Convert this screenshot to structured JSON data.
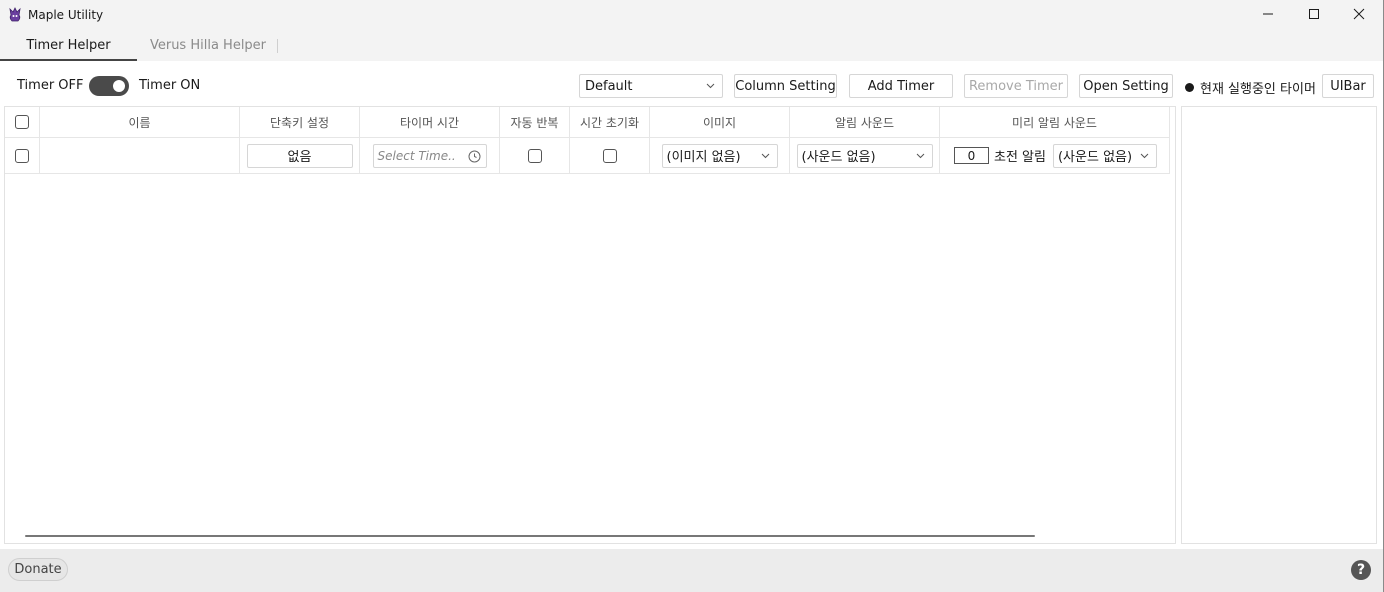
{
  "window": {
    "title": "Maple Utility",
    "controls": {
      "minimize": "minimize-icon",
      "maximize": "maximize-icon",
      "close": "close-icon"
    }
  },
  "tabs": [
    {
      "label": "Timer Helper",
      "active": true
    },
    {
      "label": "Verus Hilla Helper",
      "active": false
    }
  ],
  "toolbar": {
    "timer_off_label": "Timer OFF",
    "timer_on_label": "Timer ON",
    "toggle_state": "on",
    "preset_select": "Default",
    "column_setting": "Column Setting",
    "add_timer": "Add Timer",
    "remove_timer": "Remove Timer",
    "open_setting": "Open Setting",
    "running_timers": "현재 실행중인 타이머",
    "uibar": "UIBar"
  },
  "table": {
    "headers": {
      "name": "이름",
      "hotkey": "단축키 설정",
      "timer_time": "타이머 시간",
      "auto_repeat": "자동 반복",
      "time_reset": "시간 초기화",
      "image": "이미지",
      "alert_sound": "알림 사운드",
      "pre_alert_sound": "미리 알림 사운드"
    },
    "row": {
      "hotkey_value": "없음",
      "time_placeholder": "Select Time..",
      "image_value": "(이미지 없음)",
      "sound_value": "(사운드 없음)",
      "pre_alert_seconds": "0",
      "pre_alert_label": "초전 알림",
      "pre_alert_sound_value": "(사운드 없음)"
    }
  },
  "statusbar": {
    "donate": "Donate",
    "help": "?"
  },
  "colors": {
    "toggle_on": "#4a4a4a",
    "titlebar_bg": "#f3f3f3",
    "statusbar_bg": "#ececec"
  }
}
